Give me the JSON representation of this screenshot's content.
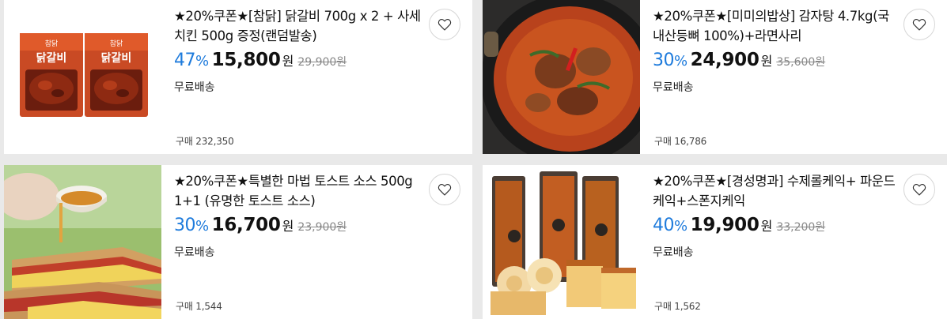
{
  "products": [
    {
      "title": "★20%쿠폰★[참닭] 닭갈비 700g x 2 + 사세치킨 500g 증정(랜덤발송)",
      "discount": "47",
      "pct": "%",
      "price": "15,800",
      "won": "원",
      "original_price": "29,900원",
      "shipping": "무료배송",
      "purchases": "구매 232,350",
      "package_text": "닭갈비",
      "brand_text": "참닭"
    },
    {
      "title": "★20%쿠폰★[미미의밥상] 감자탕 4.7kg(국내산등뼈 100%)+라면사리",
      "discount": "30",
      "pct": "%",
      "price": "24,900",
      "won": "원",
      "original_price": "35,600원",
      "shipping": "무료배송",
      "purchases": "구매 16,786"
    },
    {
      "title": "★20%쿠폰★특별한 마법 토스트 소스 500g 1+1 (유명한 토스트 소스)",
      "discount": "30",
      "pct": "%",
      "price": "16,700",
      "won": "원",
      "original_price": "23,900원",
      "shipping": "무료배송",
      "purchases": "구매 1,544"
    },
    {
      "title": "★20%쿠폰★[경성명과] 수제롤케익+ 파운드케익+스폰지케익",
      "discount": "40",
      "pct": "%",
      "price": "19,900",
      "won": "원",
      "original_price": "33,200원",
      "shipping": "무료배송",
      "purchases": "구매 1,562"
    }
  ],
  "colors": {
    "discount": "#1e7bdc",
    "background": "#e9e9e9",
    "card": "#ffffff"
  },
  "icons": [
    "heart-icon"
  ]
}
